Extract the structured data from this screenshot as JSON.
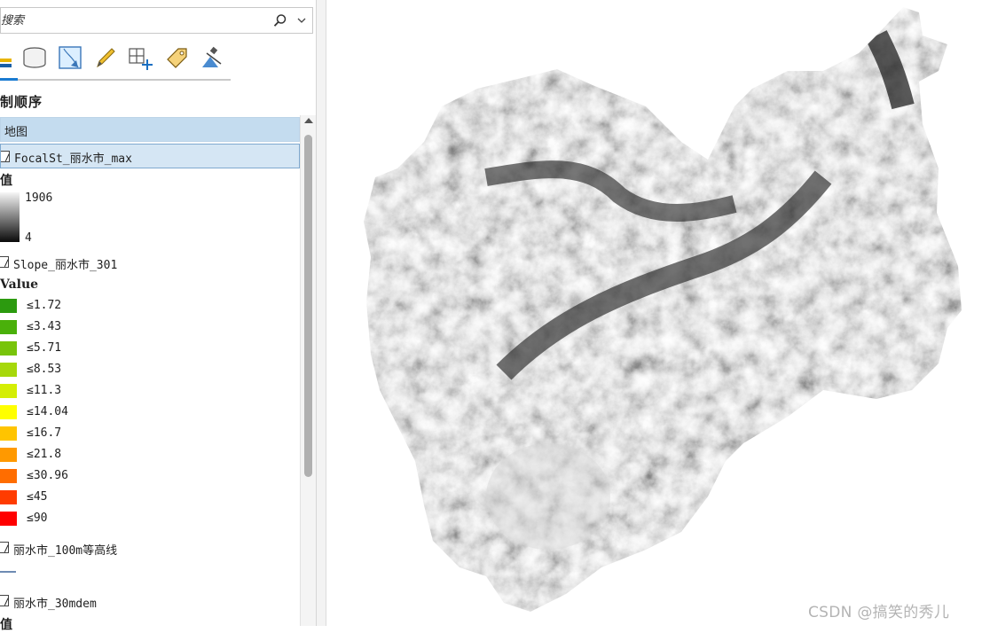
{
  "search": {
    "placeholder": "搜索"
  },
  "toolbar": {
    "icons": [
      "layers-icon",
      "database-icon",
      "map-frame-icon",
      "edit-pencil-icon",
      "add-grid-icon",
      "label-tag-icon",
      "satellite-icon"
    ]
  },
  "panel": {
    "title": "制顺序"
  },
  "tree": {
    "map_label": "地图",
    "focal_layer": {
      "name": "FocalSt_丽水市_max",
      "section": "值",
      "high": "1906",
      "low": "4"
    },
    "slope_layer": {
      "name": "Slope_丽水市_301",
      "section": "Value",
      "classes": [
        {
          "label": "≤1.72",
          "color": "#2c9a0f"
        },
        {
          "label": "≤3.43",
          "color": "#4ab00a"
        },
        {
          "label": "≤5.71",
          "color": "#78c40a"
        },
        {
          "label": "≤8.53",
          "color": "#a6d80a"
        },
        {
          "label": "≤11.3",
          "color": "#d4ee04"
        },
        {
          "label": "≤14.04",
          "color": "#ffff00"
        },
        {
          "label": "≤16.7",
          "color": "#ffc400"
        },
        {
          "label": "≤21.8",
          "color": "#ff9900"
        },
        {
          "label": "≤30.96",
          "color": "#ff6d00"
        },
        {
          "label": "≤45",
          "color": "#ff3c00"
        },
        {
          "label": "≤90",
          "color": "#ff0000"
        }
      ]
    },
    "contour_layer": {
      "name": "丽水市_100m等高线"
    },
    "dem_layer": {
      "name": "丽水市_30mdem",
      "section": "值"
    }
  },
  "watermark": "CSDN @搞笑的秀儿"
}
